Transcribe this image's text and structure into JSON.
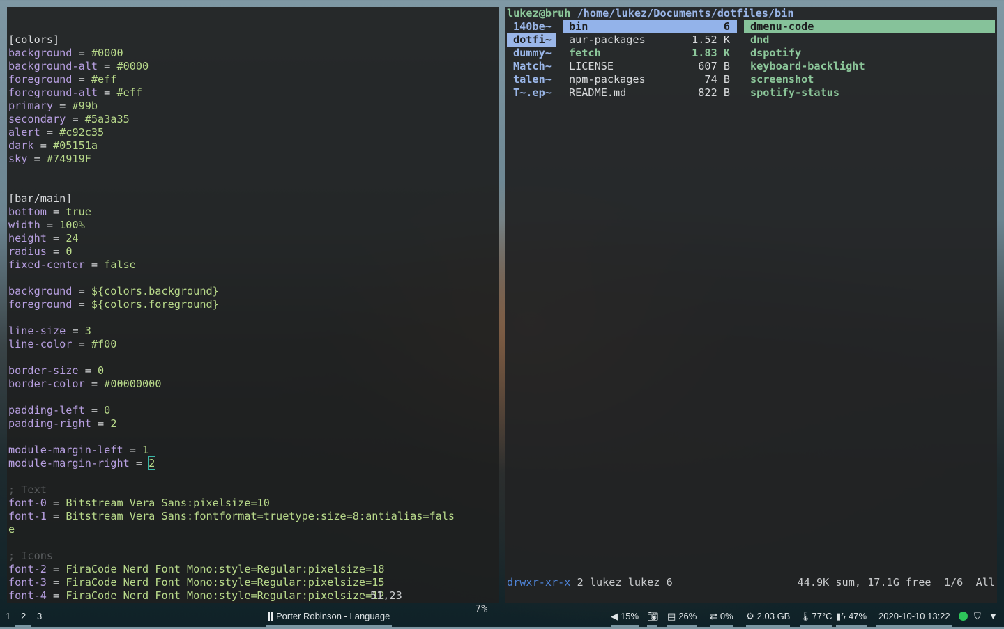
{
  "vim": {
    "lines": [
      [
        {
          "t": "[colors]",
          "c": "p"
        }
      ],
      [
        {
          "t": "background",
          "c": "k"
        },
        {
          "t": " = ",
          "c": "p"
        },
        {
          "t": "#0000",
          "c": "v"
        }
      ],
      [
        {
          "t": "background-alt",
          "c": "k"
        },
        {
          "t": " = ",
          "c": "p"
        },
        {
          "t": "#0000",
          "c": "v"
        }
      ],
      [
        {
          "t": "foreground",
          "c": "k"
        },
        {
          "t": " = ",
          "c": "p"
        },
        {
          "t": "#eff",
          "c": "v"
        }
      ],
      [
        {
          "t": "foreground-alt",
          "c": "k"
        },
        {
          "t": " = ",
          "c": "p"
        },
        {
          "t": "#eff",
          "c": "v"
        }
      ],
      [
        {
          "t": "primary",
          "c": "k"
        },
        {
          "t": " = ",
          "c": "p"
        },
        {
          "t": "#99b",
          "c": "v"
        }
      ],
      [
        {
          "t": "secondary",
          "c": "k"
        },
        {
          "t": " = ",
          "c": "p"
        },
        {
          "t": "#5a3a35",
          "c": "v"
        }
      ],
      [
        {
          "t": "alert",
          "c": "k"
        },
        {
          "t": " = ",
          "c": "p"
        },
        {
          "t": "#c92c35",
          "c": "v"
        }
      ],
      [
        {
          "t": "dark",
          "c": "k"
        },
        {
          "t": " = ",
          "c": "p"
        },
        {
          "t": "#05151a",
          "c": "v"
        }
      ],
      [
        {
          "t": "sky",
          "c": "k"
        },
        {
          "t": " = ",
          "c": "p"
        },
        {
          "t": "#74919F",
          "c": "v"
        }
      ],
      [],
      [],
      [
        {
          "t": "[bar/main]",
          "c": "p"
        }
      ],
      [
        {
          "t": "bottom",
          "c": "k"
        },
        {
          "t": " = ",
          "c": "p"
        },
        {
          "t": "true",
          "c": "v"
        }
      ],
      [
        {
          "t": "width",
          "c": "k"
        },
        {
          "t": " = ",
          "c": "p"
        },
        {
          "t": "100%",
          "c": "v"
        }
      ],
      [
        {
          "t": "height",
          "c": "k"
        },
        {
          "t": " = ",
          "c": "p"
        },
        {
          "t": "24",
          "c": "v"
        }
      ],
      [
        {
          "t": "radius",
          "c": "k"
        },
        {
          "t": " = ",
          "c": "p"
        },
        {
          "t": "0",
          "c": "v"
        }
      ],
      [
        {
          "t": "fixed-center",
          "c": "k"
        },
        {
          "t": " = ",
          "c": "p"
        },
        {
          "t": "false",
          "c": "v"
        }
      ],
      [],
      [
        {
          "t": "background",
          "c": "k"
        },
        {
          "t": " = ",
          "c": "p"
        },
        {
          "t": "${colors.background}",
          "c": "v"
        }
      ],
      [
        {
          "t": "foreground",
          "c": "k"
        },
        {
          "t": " = ",
          "c": "p"
        },
        {
          "t": "${colors.foreground}",
          "c": "v"
        }
      ],
      [],
      [
        {
          "t": "line-size",
          "c": "k"
        },
        {
          "t": " = ",
          "c": "p"
        },
        {
          "t": "3",
          "c": "v"
        }
      ],
      [
        {
          "t": "line-color",
          "c": "k"
        },
        {
          "t": " = ",
          "c": "p"
        },
        {
          "t": "#f00",
          "c": "v"
        }
      ],
      [],
      [
        {
          "t": "border-size",
          "c": "k"
        },
        {
          "t": " = ",
          "c": "p"
        },
        {
          "t": "0",
          "c": "v"
        }
      ],
      [
        {
          "t": "border-color",
          "c": "k"
        },
        {
          "t": " = ",
          "c": "p"
        },
        {
          "t": "#00000000",
          "c": "v"
        }
      ],
      [],
      [
        {
          "t": "padding-left",
          "c": "k"
        },
        {
          "t": " = ",
          "c": "p"
        },
        {
          "t": "0",
          "c": "v"
        }
      ],
      [
        {
          "t": "padding-right",
          "c": "k"
        },
        {
          "t": " = ",
          "c": "p"
        },
        {
          "t": "2",
          "c": "v"
        }
      ],
      [],
      [
        {
          "t": "module-margin-left",
          "c": "k"
        },
        {
          "t": " = ",
          "c": "p"
        },
        {
          "t": "1",
          "c": "v"
        }
      ],
      [
        {
          "t": "module-margin-right",
          "c": "k"
        },
        {
          "t": " = ",
          "c": "p"
        },
        {
          "t": "2",
          "c": "cursor"
        }
      ],
      [],
      [
        {
          "t": "; Text",
          "c": "c"
        }
      ],
      [
        {
          "t": "font-0",
          "c": "k"
        },
        {
          "t": " = ",
          "c": "p"
        },
        {
          "t": "Bitstream Vera Sans:pixelsize=10",
          "c": "v"
        }
      ],
      [
        {
          "t": "font-1",
          "c": "k"
        },
        {
          "t": " = ",
          "c": "p"
        },
        {
          "t": "Bitstream Vera Sans:fontformat=truetype:size=8:antialias=fals",
          "c": "v"
        }
      ],
      [
        {
          "t": "e",
          "c": "v"
        }
      ],
      [],
      [
        {
          "t": "; Icons",
          "c": "c"
        }
      ],
      [
        {
          "t": "font-2",
          "c": "k"
        },
        {
          "t": " = ",
          "c": "p"
        },
        {
          "t": "FiraCode Nerd Font Mono:style=Regular:pixelsize=18",
          "c": "v"
        }
      ],
      [
        {
          "t": "font-3",
          "c": "k"
        },
        {
          "t": " = ",
          "c": "p"
        },
        {
          "t": "FiraCode Nerd Font Mono:style=Regular:pixelsize=15",
          "c": "v"
        }
      ],
      [
        {
          "t": "font-4",
          "c": "k"
        },
        {
          "t": " = ",
          "c": "p"
        },
        {
          "t": "FiraCode Nerd Font Mono:style=Regular:pixelsize=12",
          "c": "v"
        }
      ]
    ],
    "status": {
      "position": "51,23",
      "percent": "7%"
    }
  },
  "ranger": {
    "header": {
      "user": "lukez@bruh",
      "path": " /home/lukez/Documents/dotfiles/bin"
    },
    "parent": [
      {
        "name": "140be~",
        "selected": false
      },
      {
        "name": "dotfi~",
        "selected": true
      },
      {
        "name": "dummy~",
        "selected": false
      },
      {
        "name": "Match~",
        "selected": false
      },
      {
        "name": "talen~",
        "selected": false
      },
      {
        "name": "T~.ep~",
        "selected": false
      }
    ],
    "current": [
      {
        "name": "bin",
        "size": "6",
        "type": "dirsel"
      },
      {
        "name": "aur-packages",
        "size": "1.52 K",
        "type": "file"
      },
      {
        "name": "fetch",
        "size": "1.83 K",
        "type": "exec"
      },
      {
        "name": "LICENSE",
        "size": "607 B",
        "type": "file"
      },
      {
        "name": "npm-packages",
        "size": "74 B",
        "type": "file"
      },
      {
        "name": "README.md",
        "size": "822 B",
        "type": "file"
      }
    ],
    "preview": [
      {
        "name": "dmenu-code",
        "selected": true
      },
      {
        "name": "dnd",
        "selected": false
      },
      {
        "name": "dspotify",
        "selected": false
      },
      {
        "name": "keyboard-backlight",
        "selected": false
      },
      {
        "name": "screenshot",
        "selected": false
      },
      {
        "name": "spotify-status",
        "selected": false
      }
    ],
    "status": {
      "perms": "drwxr-xr-x",
      "info": " 2 lukez lukez 6",
      "summary": "44.9K sum, 17.1G free  1/6  All"
    }
  },
  "bar": {
    "workspaces": [
      "1",
      "2",
      "3"
    ],
    "active_workspace": "2",
    "media": "Porter Robinson - Language",
    "volume": {
      "icon": "volume-icon",
      "value": "15%"
    },
    "screenshot": {
      "icon": "camera-icon"
    },
    "memory": {
      "icon": "memory-icon",
      "value": "26%"
    },
    "swap": {
      "icon": "swap-icon",
      "value": "0%"
    },
    "disk": {
      "icon": "chip-icon",
      "value": "2.03 GB"
    },
    "temp": {
      "icon": "thermometer-icon",
      "value": "77°C"
    },
    "battery": {
      "icon": "battery-charging-icon",
      "value": "47%"
    },
    "datetime": "2020-10-10 13:22",
    "tray": [
      "spotify-icon",
      "shield-icon",
      "wifi-icon"
    ]
  }
}
